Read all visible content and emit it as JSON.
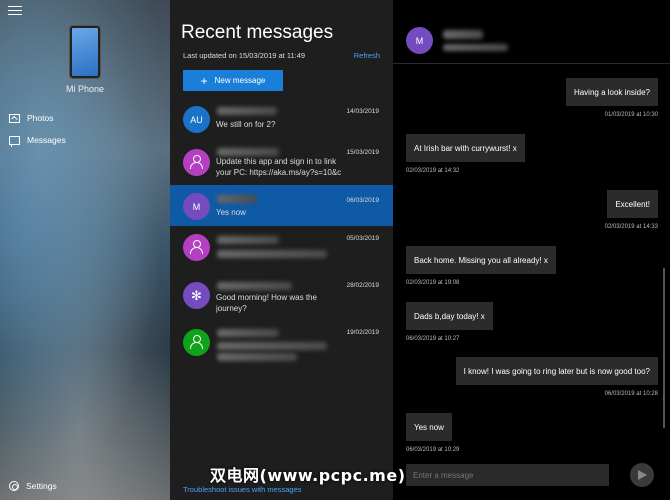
{
  "left": {
    "phone_name": "Mi Phone",
    "nav": [
      {
        "label": "Photos",
        "icon": "photo-icon"
      },
      {
        "label": "Messages",
        "icon": "message-icon"
      }
    ],
    "settings_label": "Settings"
  },
  "middle": {
    "title": "Recent messages",
    "updated": "Last updated on 15/03/2019 at 11:49",
    "refresh": "Refresh",
    "new_message": "New message",
    "troubleshoot": "Troubleshoot issues with messages",
    "conversations": [
      {
        "initials": "AU",
        "avatar_color": "#1a73c8",
        "preview": "We still on for 2?",
        "date": "14/03/2019"
      },
      {
        "initials": "",
        "avatar_color": "#b43fc1",
        "preview": "Update this app and sign in to link your PC: https://aka.ms/ay?s=10&c",
        "date": "15/03/2019"
      },
      {
        "initials": "M",
        "avatar_color": "#744cbf",
        "preview": "Yes now",
        "date": "06/03/2019",
        "selected": true
      },
      {
        "initials": "",
        "avatar_color": "#b43fc1",
        "preview": "",
        "date": "05/03/2019"
      },
      {
        "initials": "",
        "avatar_color": "#744cbf",
        "preview": "Good morning! How was the journey?",
        "date": "28/02/2019"
      },
      {
        "initials": "",
        "avatar_color": "#10a31a",
        "preview": "",
        "date": "19/02/2019"
      }
    ]
  },
  "right": {
    "header_initials": "M",
    "messages": [
      {
        "dir": "out",
        "text": "Having a look inside?",
        "time": "01/03/2019 at 10:30"
      },
      {
        "dir": "in",
        "text": "At Irish bar with currywurst! x",
        "time": "02/03/2019 at 14:32"
      },
      {
        "dir": "out",
        "text": "Excellent!",
        "time": "02/03/2019 at 14:33"
      },
      {
        "dir": "in",
        "text": "Back home. Missing you all already! x",
        "time": "02/03/2019 at 19:08"
      },
      {
        "dir": "in",
        "text": "Dads b,day today! x",
        "time": "06/03/2019 at 10:27"
      },
      {
        "dir": "out",
        "text": "I know! I was going to ring later but is now good too?",
        "time": "06/03/2019 at 10:28"
      },
      {
        "dir": "in",
        "text": "Yes now",
        "time": "06/03/2019 at 10:29"
      }
    ],
    "compose_placeholder": "Enter a message"
  },
  "watermark": "双电网(www.pcpc.me)"
}
